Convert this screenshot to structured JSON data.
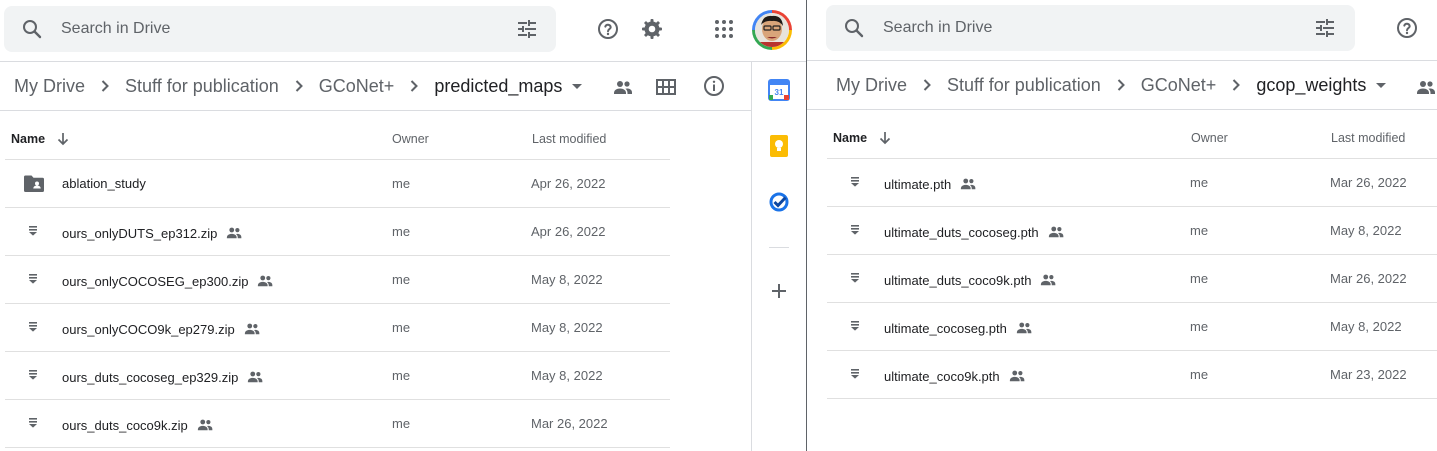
{
  "left": {
    "search": {
      "placeholder": "Search in Drive"
    },
    "breadcrumb": [
      "My Drive",
      "Stuff for publication",
      "GCoNet+",
      "predicted_maps"
    ],
    "columns": {
      "name": "Name",
      "owner": "Owner",
      "modified": "Last modified"
    },
    "files": [
      {
        "name": "ablation_study",
        "type": "shared-folder",
        "shared": false,
        "owner": "me",
        "modified": "Apr 26, 2022"
      },
      {
        "name": "ours_onlyDUTS_ep312.zip",
        "type": "file",
        "shared": true,
        "owner": "me",
        "modified": "Apr 26, 2022"
      },
      {
        "name": "ours_onlyCOCOSEG_ep300.zip",
        "type": "file",
        "shared": true,
        "owner": "me",
        "modified": "May 8, 2022"
      },
      {
        "name": "ours_onlyCOCO9k_ep279.zip",
        "type": "file",
        "shared": true,
        "owner": "me",
        "modified": "May 8, 2022"
      },
      {
        "name": "ours_duts_cocoseg_ep329.zip",
        "type": "file",
        "shared": true,
        "owner": "me",
        "modified": "May 8, 2022"
      },
      {
        "name": "ours_duts_coco9k.zip",
        "type": "file",
        "shared": true,
        "owner": "me",
        "modified": "Mar 26, 2022"
      }
    ]
  },
  "right": {
    "search": {
      "placeholder": "Search in Drive"
    },
    "breadcrumb": [
      "My Drive",
      "Stuff for publication",
      "GCoNet+",
      "gcop_weights"
    ],
    "columns": {
      "name": "Name",
      "owner": "Owner",
      "modified": "Last modified"
    },
    "files": [
      {
        "name": "ultimate.pth",
        "type": "file",
        "shared": true,
        "owner": "me",
        "modified": "Mar 26, 2022"
      },
      {
        "name": "ultimate_duts_cocoseg.pth",
        "type": "file",
        "shared": true,
        "owner": "me",
        "modified": "May 8, 2022"
      },
      {
        "name": "ultimate_duts_coco9k.pth",
        "type": "file",
        "shared": true,
        "owner": "me",
        "modified": "Mar 26, 2022"
      },
      {
        "name": "ultimate_cocoseg.pth",
        "type": "file",
        "shared": true,
        "owner": "me",
        "modified": "May 8, 2022"
      },
      {
        "name": "ultimate_coco9k.pth",
        "type": "file",
        "shared": true,
        "owner": "me",
        "modified": "Mar 23, 2022"
      }
    ]
  },
  "side_panel": {
    "calendar_day": "31",
    "items": [
      "calendar-icon",
      "keep-icon",
      "tasks-icon",
      "add-icon"
    ]
  },
  "icons": [
    "search-icon",
    "tune-icon",
    "help-icon",
    "settings-icon",
    "apps-icon",
    "avatar",
    "chevron-right-icon",
    "dropdown-icon",
    "shared-icon",
    "grid-view-icon",
    "info-icon",
    "sort-arrow-icon",
    "file-icon",
    "shared-folder-icon"
  ],
  "colors": {
    "icon": "#5f6368",
    "text": "#202124",
    "search_bg": "#f1f3f4",
    "divider": "#dadce0",
    "calendar_blue": "#4285f4",
    "keep_yellow": "#fbbc04",
    "tasks_blue": "#1a73e8"
  }
}
